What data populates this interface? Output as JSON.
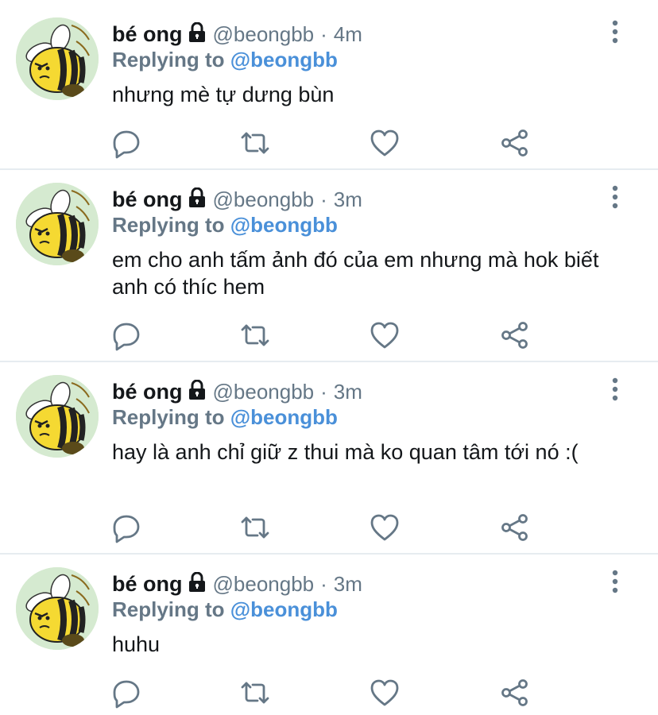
{
  "colors": {
    "name": "#14171a",
    "muted": "#657786",
    "mention": "#4a90d9",
    "divider": "#e6ecf0",
    "icon": "#657786"
  },
  "icons": {
    "reply": "comment-icon",
    "retweet": "retweet-icon",
    "like": "heart-icon",
    "share": "share-icon",
    "more": "more-vertical-icon",
    "lock": "lock-icon"
  },
  "tweets": [
    {
      "name": "bé ong",
      "handle": "@beongbb",
      "separator": "·",
      "time": "4m",
      "replying_label": "Replying to",
      "replying_to": "@beongbb",
      "text": "nhưng mè tự dưng bùn"
    },
    {
      "name": "bé ong",
      "handle": "@beongbb",
      "separator": "·",
      "time": "3m",
      "replying_label": "Replying to",
      "replying_to": "@beongbb",
      "text": "em cho anh tấm ảnh đó của em nhưng mà hok biết anh có thíc hem"
    },
    {
      "name": "bé ong",
      "handle": "@beongbb",
      "separator": "·",
      "time": "3m",
      "replying_label": "Replying to",
      "replying_to": "@beongbb",
      "text": "hay là anh chỉ giữ z thui mà ko quan tâm tới nó :("
    },
    {
      "name": "bé ong",
      "handle": "@beongbb",
      "separator": "·",
      "time": "3m",
      "replying_label": "Replying to",
      "replying_to": "@beongbb",
      "text": "huhu"
    }
  ]
}
